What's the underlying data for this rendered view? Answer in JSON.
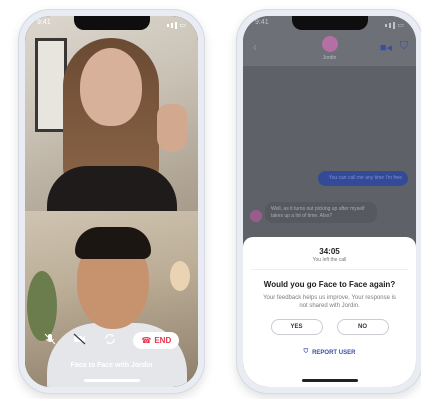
{
  "left_phone": {
    "status_time": "9:41",
    "controls": {
      "mute_icon": "mic-off-icon",
      "camera_icon": "camera-off-icon",
      "flip_icon": "flip-camera-icon",
      "end_label": "END"
    },
    "caption": "Face to Face with Jordin"
  },
  "right_phone": {
    "status_time": "9:41",
    "header": {
      "name": "Jordin",
      "video_icon": "video-icon",
      "shield_icon": "shield-icon"
    },
    "messages": {
      "outgoing": "You can call me any time I'm free",
      "incoming": "Well, as it turns out picking up after myself takes up a lot of time. Also?"
    },
    "sheet": {
      "duration": "34:05",
      "subtext": "You left the call",
      "question": "Would you go Face to Face again?",
      "note": "Your feedback helps us improve. Your response is not shared with Jordin.",
      "yes_label": "YES",
      "no_label": "NO",
      "report_label": "REPORT USER"
    }
  },
  "colors": {
    "accent": "#3a4ea8",
    "end_red": "#e8364c"
  }
}
